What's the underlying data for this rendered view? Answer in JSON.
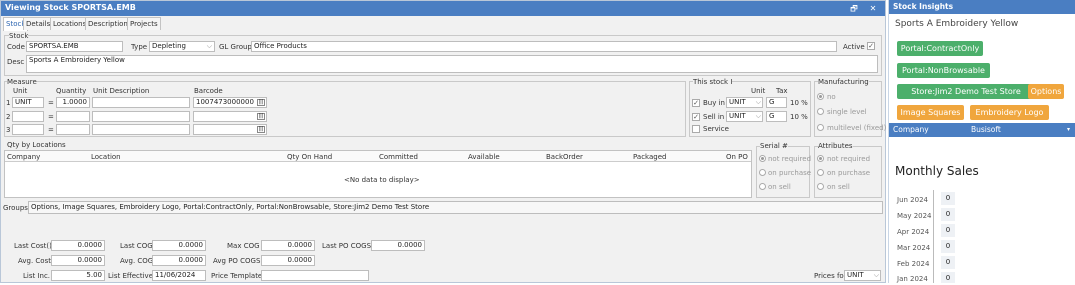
{
  "window": {
    "title": "Viewing Stock SPORTSA.EMB",
    "restore_icon": "restore-icon",
    "close_icon": "close-icon",
    "restore_glyph": "🗗",
    "close_glyph": "✕"
  },
  "tabs": [
    "Stock",
    "Details",
    "Locations",
    "Descriptions",
    "Projects"
  ],
  "stock": {
    "section_label": "Stock",
    "code_label": "Code",
    "code": "SPORTSA.EMB",
    "type_label": "Type",
    "type": "Depleting",
    "gl_label": "GL Group",
    "gl": "Office Products",
    "active_label": "Active",
    "desc_label": "Desc",
    "desc": "Sports A Embroidery Yellow"
  },
  "measure": {
    "section_label": "Measure",
    "unit_h": "Unit",
    "qty_h": "Quantity",
    "udesc_h": "Unit Description",
    "barcode_h": "Barcode",
    "rows": [
      {
        "n": "1",
        "unit": "UNIT",
        "eq": "=",
        "qty": "1.0000",
        "barcode": "1007473000000"
      },
      {
        "n": "2",
        "unit": "",
        "eq": "=",
        "qty": "",
        "barcode": ""
      },
      {
        "n": "3",
        "unit": "",
        "eq": "=",
        "qty": "",
        "barcode": ""
      }
    ]
  },
  "thisstock": {
    "label": "This stock I",
    "unit_h": "Unit",
    "tax_h": "Tax",
    "buy_label": "Buy in",
    "buy_unit": "UNIT",
    "buy_tax": "G",
    "buy_pct": "10 %",
    "sell_label": "Sell in",
    "sell_unit": "UNIT",
    "sell_tax": "G",
    "sell_pct": "10 %",
    "service_label": "Service"
  },
  "manufacturing": {
    "label": "Manufacturing",
    "opts": [
      "no",
      "single level",
      "multilevel (fixed)"
    ]
  },
  "qty_locations": {
    "label": "Qty by Locations",
    "cols": [
      "Company",
      "Location",
      "Qty On Hand",
      "Committed",
      "Available",
      "BackOrder",
      "Packaged",
      "On PO"
    ],
    "empty": "<No data to display>"
  },
  "serial": {
    "label": "Serial #",
    "opts": [
      "not required",
      "on purchase",
      "on sell"
    ]
  },
  "attributes": {
    "label": "Attributes",
    "opts": [
      "not required",
      "on purchase",
      "on sell"
    ]
  },
  "groups": {
    "label": "Groups",
    "value": "Options, Image Squares, Embroidery Logo, Portal:ContractOnly, Portal:NonBrowsable, Store:Jim2 Demo Test Store"
  },
  "costs": {
    "last_cost_l": "Last Cost()",
    "last_cost": "0.0000",
    "last_cog_l": "Last COG",
    "last_cog": "0.0000",
    "max_cog_l": "Max COG",
    "max_cog": "0.0000",
    "last_po_l": "Last PO COGS",
    "last_po": "0.0000",
    "avg_cost_l": "Avg. Cost",
    "avg_cost": "0.0000",
    "avg_cog_l": "Avg. COG",
    "avg_cog": "0.0000",
    "avg_po_l": "Avg PO COGS",
    "avg_po": "0.0000",
    "list_inc_l": "List Inc.",
    "list_inc": "5.00",
    "list_eff_l": "List Effective",
    "list_eff": "11/06/2024",
    "price_tpl_l": "Price Template",
    "price_tpl": "",
    "prices_for_l": "Prices for",
    "prices_for": "UNIT"
  },
  "insights": {
    "title": "Stock Insights",
    "name": "Sports A Embroidery Yellow",
    "buttons": [
      {
        "label": "Portal:ContractOnly",
        "color": "green"
      },
      {
        "label": "Portal:NonBrowsable",
        "color": "green"
      },
      {
        "label": "Store:Jim2 Demo Test Store",
        "color": "green"
      },
      {
        "label": "Options",
        "color": "orange"
      },
      {
        "label": "Image Squares",
        "color": "orange"
      },
      {
        "label": "Embroidery Logo",
        "color": "orange"
      }
    ],
    "company_label": "Company",
    "company": "Busisoft",
    "monthly_title": "Monthly Sales",
    "months": [
      {
        "m": "Jun 2024",
        "v": "0"
      },
      {
        "m": "May 2024",
        "v": "0"
      },
      {
        "m": "Apr 2024",
        "v": "0"
      },
      {
        "m": "Mar 2024",
        "v": "0"
      },
      {
        "m": "Feb 2024",
        "v": "0"
      },
      {
        "m": "Jan 2024",
        "v": "0"
      }
    ]
  }
}
